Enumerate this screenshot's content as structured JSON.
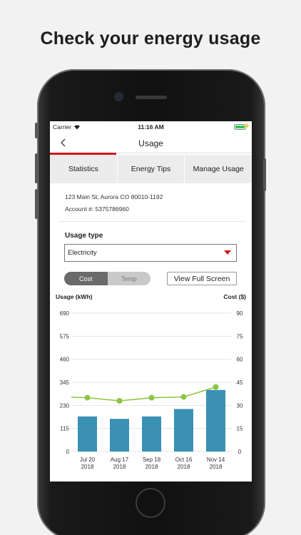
{
  "headline": "Check your energy usage",
  "status": {
    "carrier": "Carrier",
    "time": "11:16 AM"
  },
  "nav": {
    "title": "Usage"
  },
  "tabs": [
    "Statistics",
    "Energy Tips",
    "Manage Usage"
  ],
  "account": {
    "address": "123 Main St, Aurora CO 80010-1192",
    "account_line": "Account #: 5375786960"
  },
  "usage_type": {
    "label": "Usage type",
    "selected": "Electricity"
  },
  "toggle": {
    "options": [
      "Cost",
      "Temp"
    ],
    "selected": "Cost"
  },
  "full_screen_label": "View Full Screen",
  "colors": {
    "accent": "#d0161b",
    "bar": "#3a91b3",
    "line": "#8cc63f"
  },
  "chart_data": {
    "type": "bar",
    "categories": [
      [
        "Jul 20",
        "2018"
      ],
      [
        "Aug 17",
        "2018"
      ],
      [
        "Sep 18",
        "2018"
      ],
      [
        "Oct 16",
        "2018"
      ],
      [
        "Nov 14",
        "2018"
      ]
    ],
    "ylabel": "Usage (kWh)",
    "y2label": "Cost ($)",
    "ylim": [
      0,
      690
    ],
    "y2lim": [
      0,
      90
    ],
    "yticks": [
      0,
      115,
      230,
      345,
      460,
      575,
      690
    ],
    "y2ticks": [
      0,
      15,
      30,
      45,
      60,
      75,
      90
    ],
    "series": [
      {
        "type": "bar",
        "axis": "left",
        "values": [
          175,
          163,
          175,
          212,
          307
        ]
      },
      {
        "type": "line",
        "axis": "right",
        "values": [
          35,
          33,
          35,
          35.5,
          42
        ]
      }
    ],
    "grid": true
  }
}
